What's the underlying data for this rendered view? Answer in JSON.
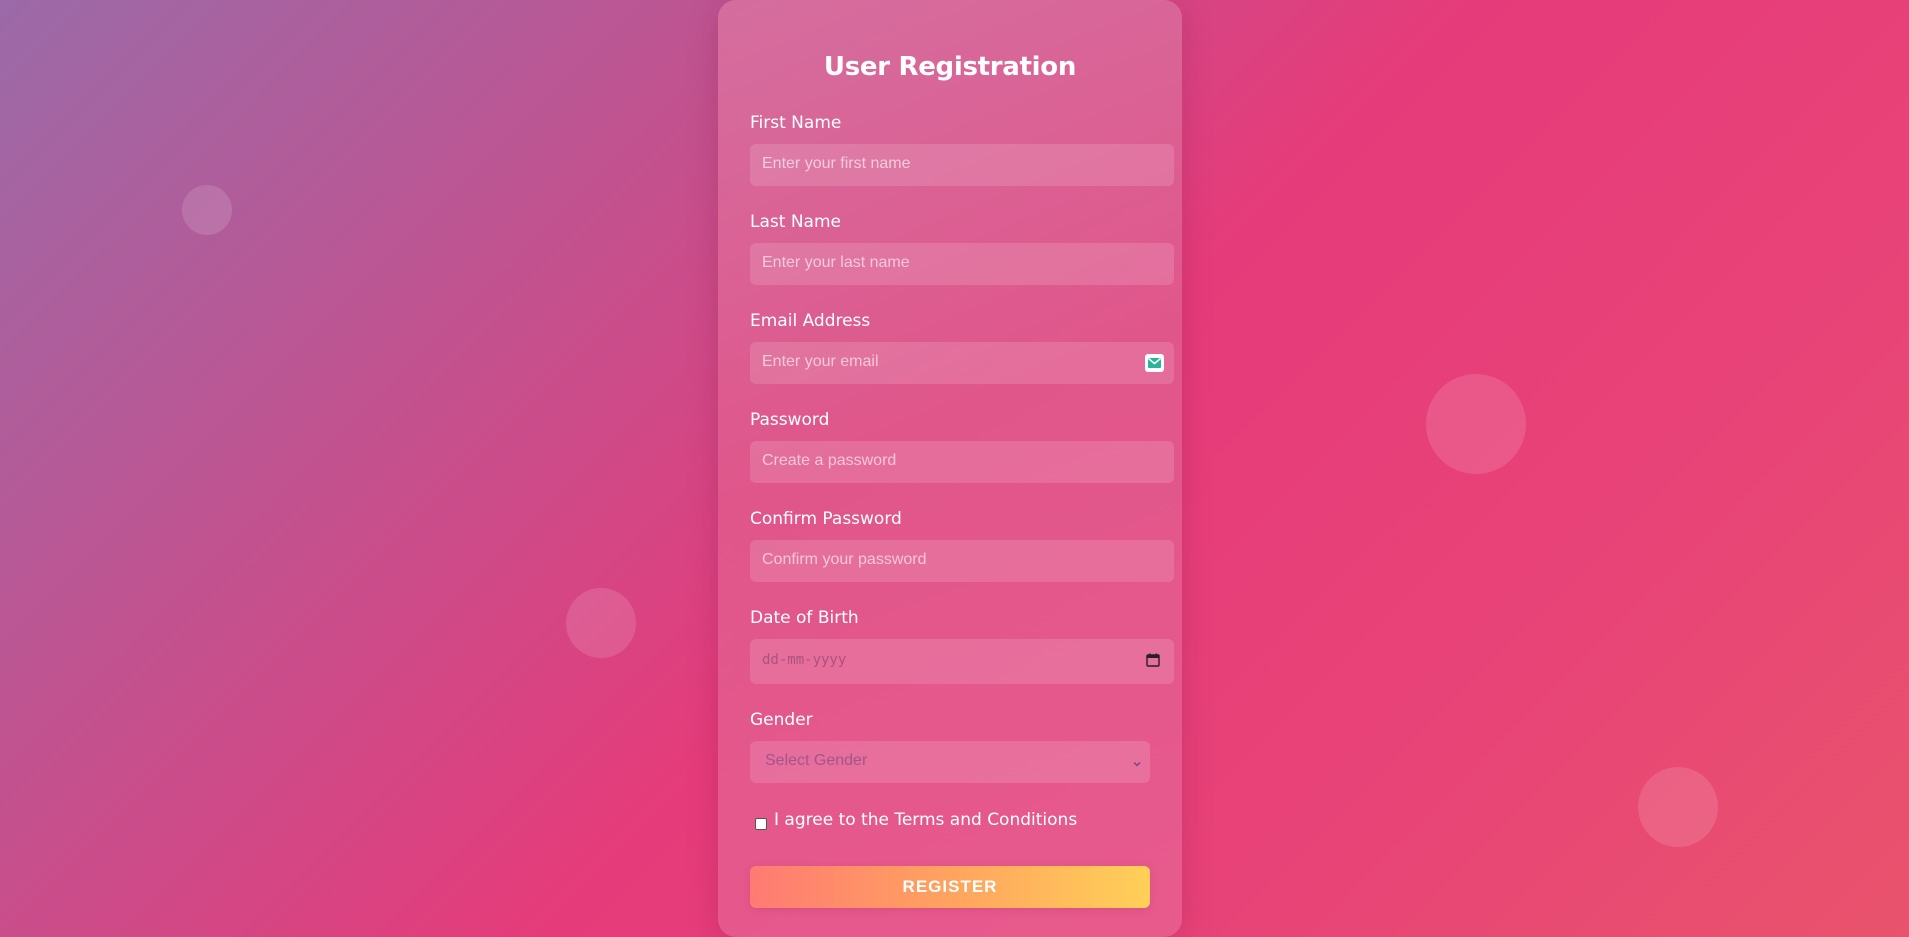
{
  "form": {
    "title": "User Registration",
    "fields": [
      {
        "label": "First Name",
        "placeholder": "Enter your first name"
      },
      {
        "label": "Last Name",
        "placeholder": "Enter your last name"
      },
      {
        "label": "Email Address",
        "placeholder": "Enter your email"
      },
      {
        "label": "Password",
        "placeholder": "Create a password"
      },
      {
        "label": "Confirm Password",
        "placeholder": "Confirm your password"
      },
      {
        "label": "Date of Birth",
        "placeholder": "dd-mm-yyyy"
      },
      {
        "label": "Gender",
        "placeholder": "Select Gender"
      }
    ],
    "terms_label": "I agree to the Terms and Conditions",
    "submit_label": "REGISTER",
    "terms_checked": false
  },
  "icons": {
    "email": "mail-icon",
    "date": "calendar-icon",
    "select": "chevron-down-icon"
  },
  "colors": {
    "button_gradient_start": "#ff7a73",
    "button_gradient_end": "#ffd058",
    "background_accent": "#e63b7a",
    "mail_icon_accent": "#2ab39a"
  }
}
